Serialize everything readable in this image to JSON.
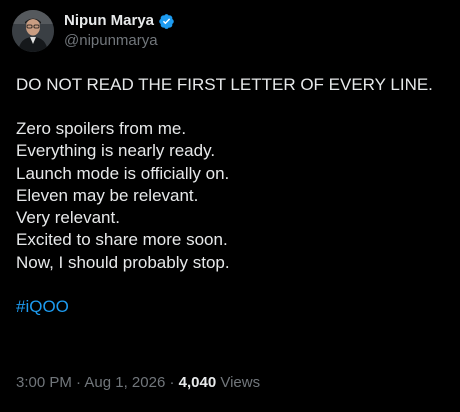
{
  "author": {
    "display_name": "Nipun Marya",
    "handle": "@nipunmarya",
    "verified_color": "#1d9bf0"
  },
  "tweet": {
    "intro": "DO NOT READ THE FIRST LETTER OF EVERY LINE.",
    "lines": [
      "Zero spoilers from me.",
      "Everything is nearly ready.",
      "Launch mode is officially on.",
      "Eleven may be relevant.",
      "Very relevant.",
      "Excited to share more soon.",
      "Now, I should probably stop."
    ],
    "hashtag": "#iQOO"
  },
  "meta": {
    "time": "3:00 PM",
    "separator": "·",
    "date": "Aug 1, 2026",
    "views_count": "4,040",
    "views_label": "Views"
  }
}
